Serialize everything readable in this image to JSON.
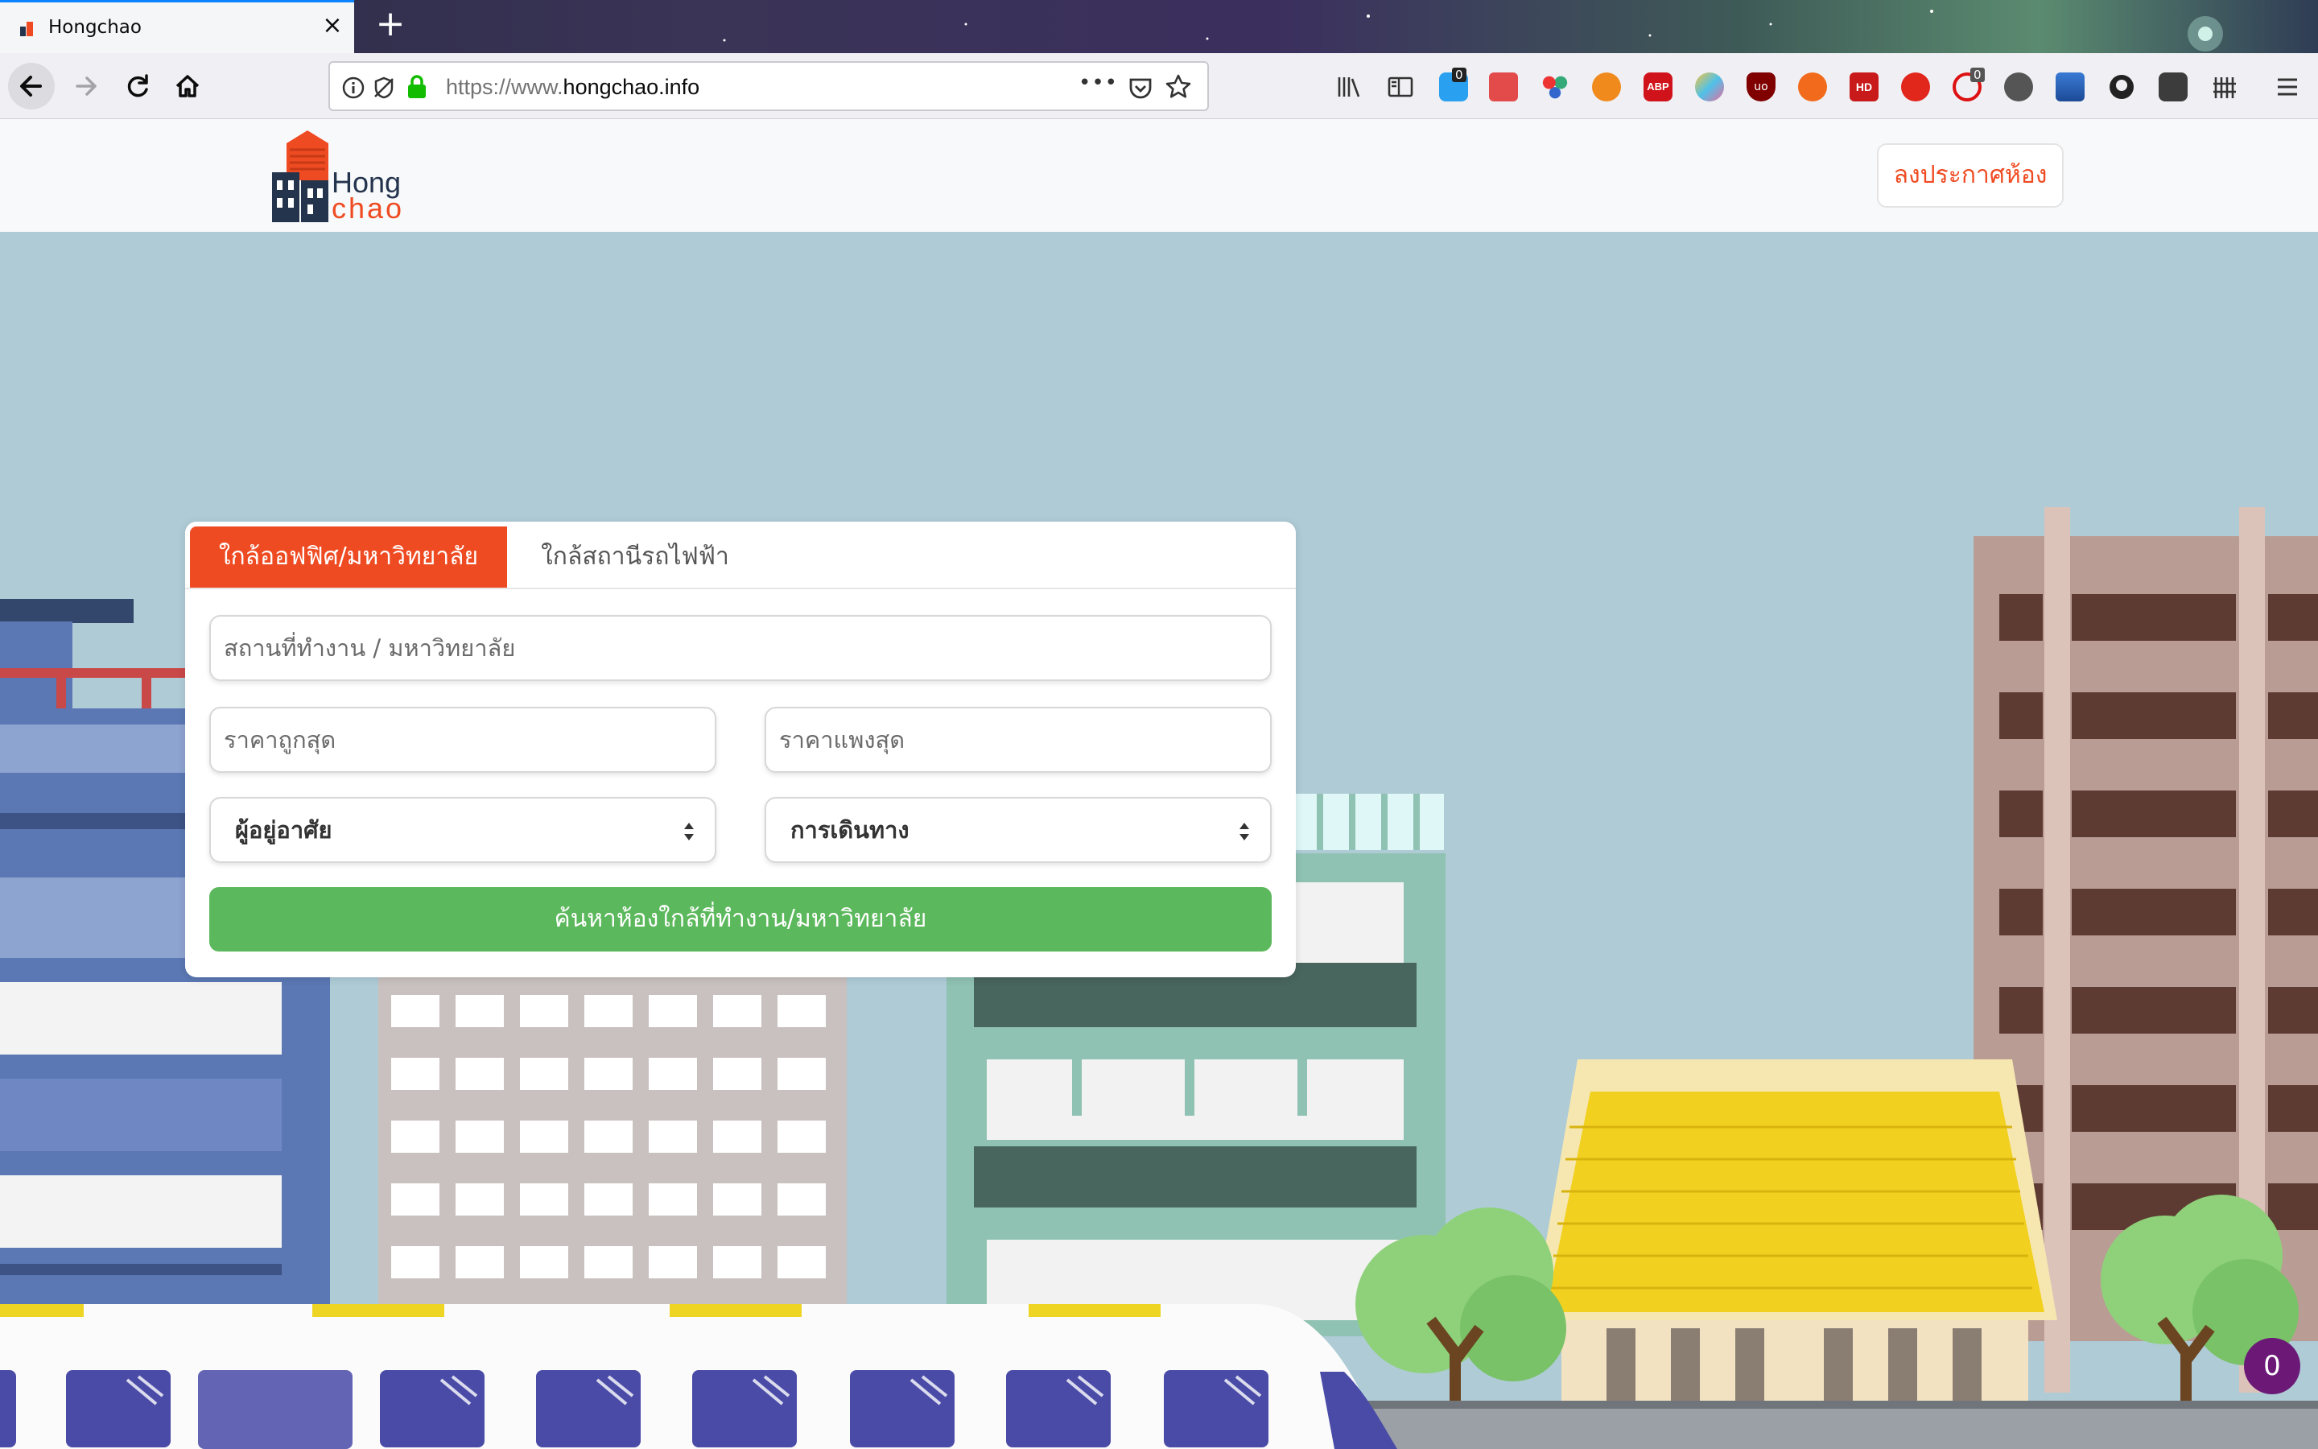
{
  "browser": {
    "tab_title": "Hongchao",
    "new_tab": "+",
    "close_tab": "×",
    "url_prefix": "https://www.",
    "url_domain": "hongchao.info",
    "page_actions": "•••",
    "extension_badges": [
      "0",
      "0"
    ]
  },
  "header": {
    "logo_line1": "Hong",
    "logo_line2": "chao",
    "post_button": "ลงประกาศห้อง"
  },
  "search": {
    "tabs": [
      "ใกล้ออฟฟิศ/มหาวิทยาลัย",
      "ใกล้สถานีรถไฟฟ้า"
    ],
    "location_placeholder": "สถานที่ทำงาน / มหาวิทยาลัย",
    "min_price_placeholder": "ราคาถูกสุด",
    "max_price_placeholder": "ราคาแพงสุด",
    "resident_select": "ผู้อยู่อาศัย",
    "transport_select": "การเดินทาง",
    "submit": "ค้นหาห้องใกล้ที่ทำงาน/มหาวิทยาลัย"
  },
  "notification_count": "0",
  "colors": {
    "accent": "#ef4b22",
    "search_button": "#5cb85c",
    "sky": "#aecbd6",
    "badge": "#6b1877"
  }
}
